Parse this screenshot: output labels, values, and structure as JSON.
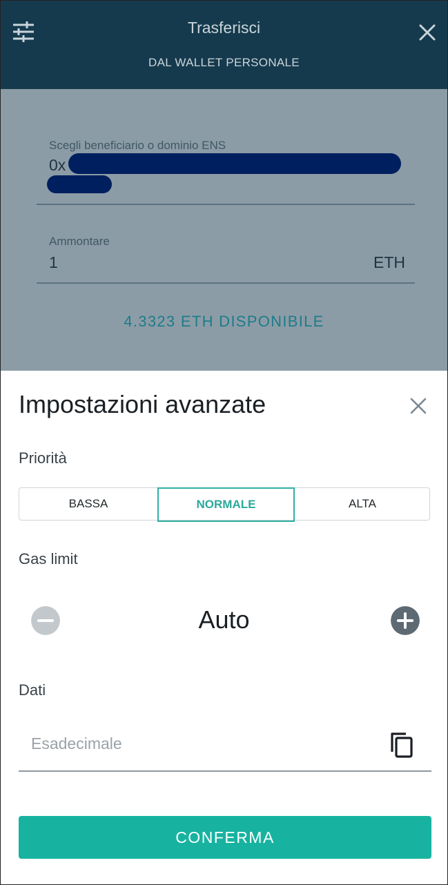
{
  "header": {
    "title": "Trasferisci",
    "subtitle": "DAL WALLET PERSONALE"
  },
  "form": {
    "recipient_label": "Scegli beneficiario o dominio ENS",
    "recipient_prefix": "0x",
    "amount_label": "Ammontare",
    "amount_value": "1",
    "amount_unit": "ETH",
    "available": "4.3323 ETH DISPONIBILE"
  },
  "advanced": {
    "title": "Impostazioni avanzate",
    "priority_label": "Priorità",
    "priority_options": [
      "BASSA",
      "NORMALE",
      "ALTA"
    ],
    "priority_selected": "NORMALE",
    "gas_limit_label": "Gas limit",
    "gas_limit_value": "Auto",
    "data_label": "Dati",
    "data_placeholder": "Esadecimale",
    "confirm_label": "CONFERMA"
  },
  "colors": {
    "header_bg": "#163a4d",
    "accent": "#17b3a0",
    "redaction": "#001f5e"
  },
  "icons": [
    "filter-icon",
    "close-icon",
    "minus-icon",
    "plus-icon",
    "copy-icon"
  ]
}
